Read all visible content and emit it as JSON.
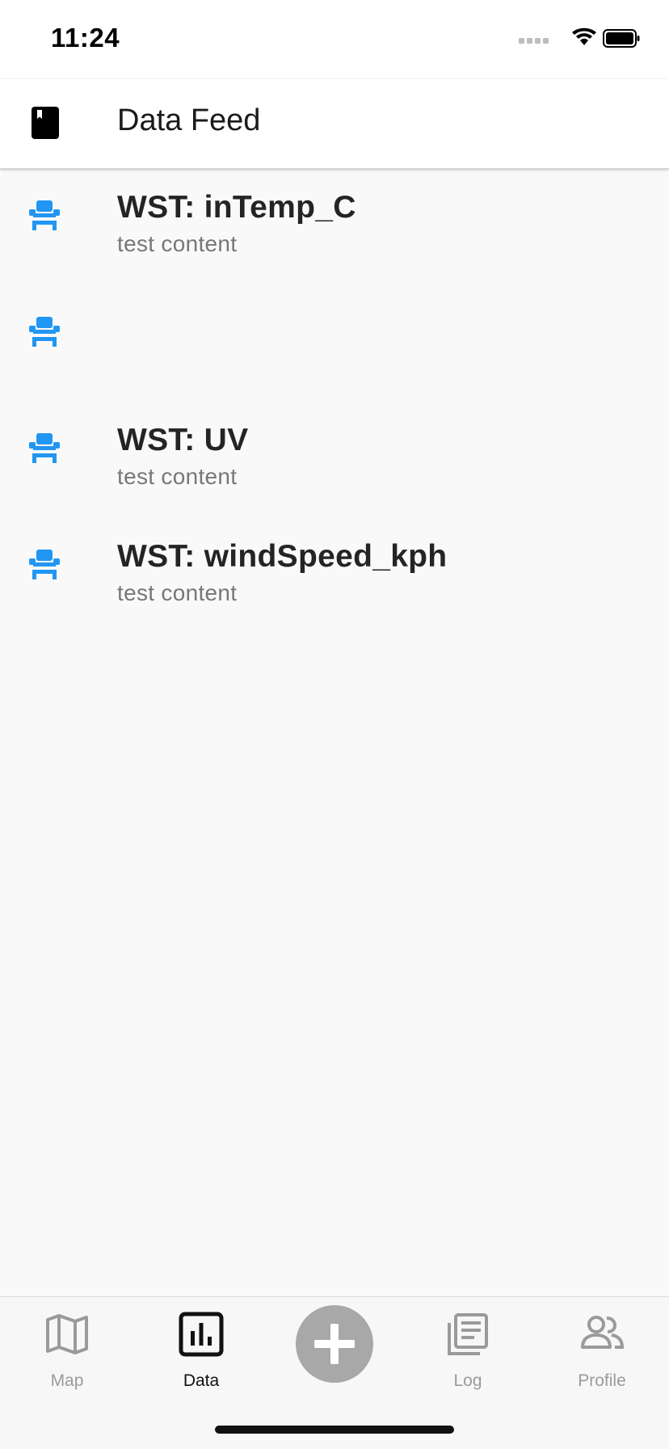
{
  "status_bar": {
    "time": "11:24"
  },
  "app_bar": {
    "title": "Data Feed",
    "icon": "book-icon"
  },
  "feed": {
    "icon_color": "#2196F3",
    "items": [
      {
        "title": "WST: inTemp_C",
        "subtitle": "test content",
        "icon": "seat-icon"
      },
      {
        "title": "",
        "subtitle": "",
        "icon": "seat-icon"
      },
      {
        "title": "WST: UV",
        "subtitle": "test content",
        "icon": "seat-icon"
      },
      {
        "title": "WST: windSpeed_kph",
        "subtitle": "test content",
        "icon": "seat-icon"
      }
    ]
  },
  "bottom_nav": {
    "items": [
      {
        "label": "Map",
        "icon": "map-icon",
        "active": false
      },
      {
        "label": "Data",
        "icon": "bar-chart-icon",
        "active": true
      },
      {
        "label": "",
        "icon": "add-icon",
        "active": false
      },
      {
        "label": "Log",
        "icon": "library-books-icon",
        "active": false
      },
      {
        "label": "Profile",
        "icon": "people-icon",
        "active": false
      }
    ]
  }
}
